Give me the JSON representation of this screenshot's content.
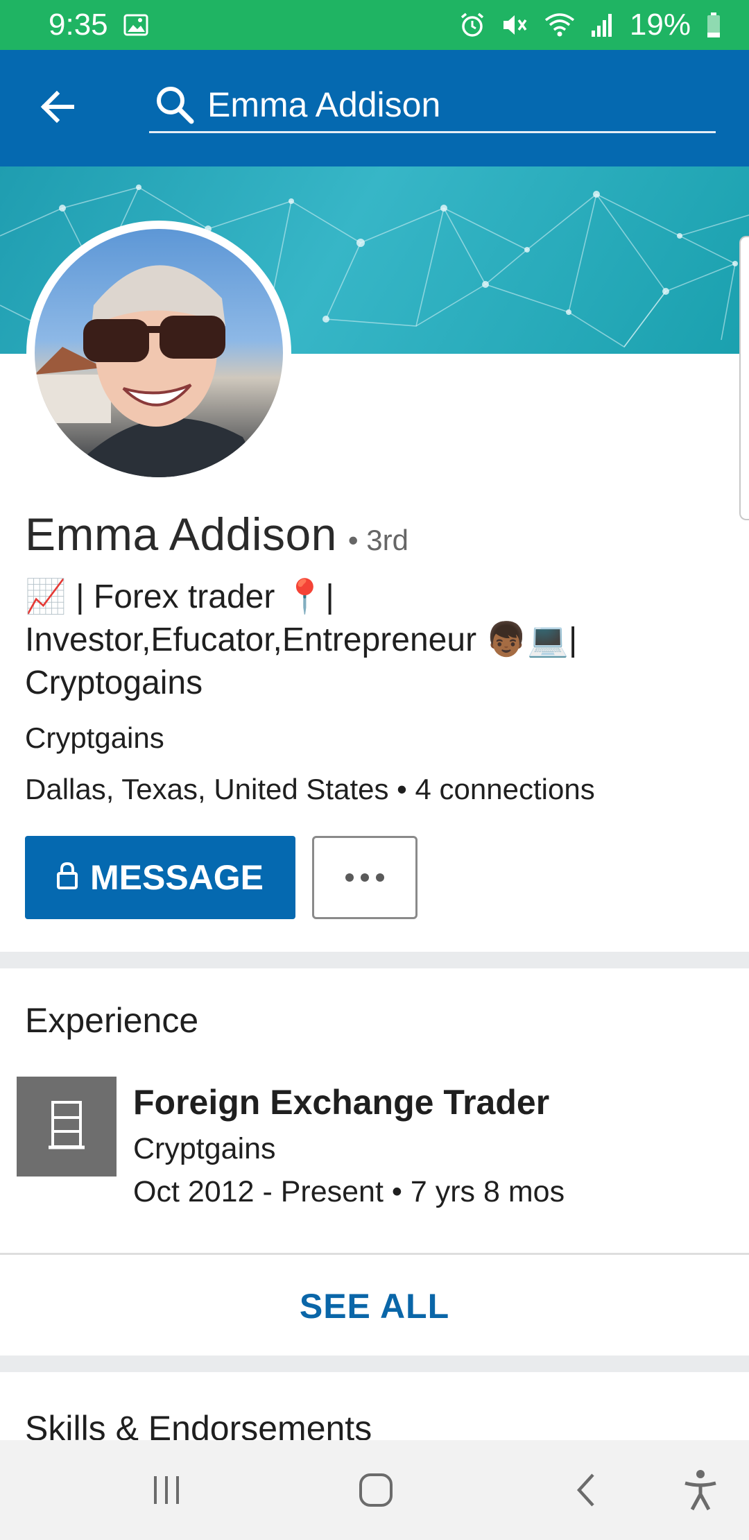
{
  "status": {
    "time": "9:35",
    "battery": "19%",
    "icons": [
      "image-icon",
      "alarm-icon",
      "mute-icon",
      "wifi-icon",
      "signal-icon",
      "battery-icon"
    ]
  },
  "search": {
    "value": "Emma Addison",
    "placeholder": "Search"
  },
  "profile": {
    "name": "Emma Addison",
    "degree": "• 3rd",
    "headline": "📈 | Forex trader 📍|\nInvestor,Efucator,Entrepreneur  👦🏾💻|\nCryptogains",
    "company": "Cryptgains",
    "location": "Dallas, Texas, United States • 4 connections"
  },
  "actions": {
    "message_label": "MESSAGE",
    "more_icon": "more-horizontal-icon"
  },
  "experience": {
    "section_title": "Experience",
    "items": [
      {
        "title": "Foreign Exchange Trader",
        "company": "Cryptgains",
        "dates": "Oct 2012 - Present • 7 yrs 8 mos",
        "logo_icon": "building-icon"
      }
    ],
    "see_all_label": "SEE ALL"
  },
  "skills": {
    "section_title": "Skills & Endorsements"
  },
  "colors": {
    "status_bar": "#1fb463",
    "app_bar": "#0569b0",
    "primary_button": "#0569b0",
    "link": "#0a66a8"
  }
}
